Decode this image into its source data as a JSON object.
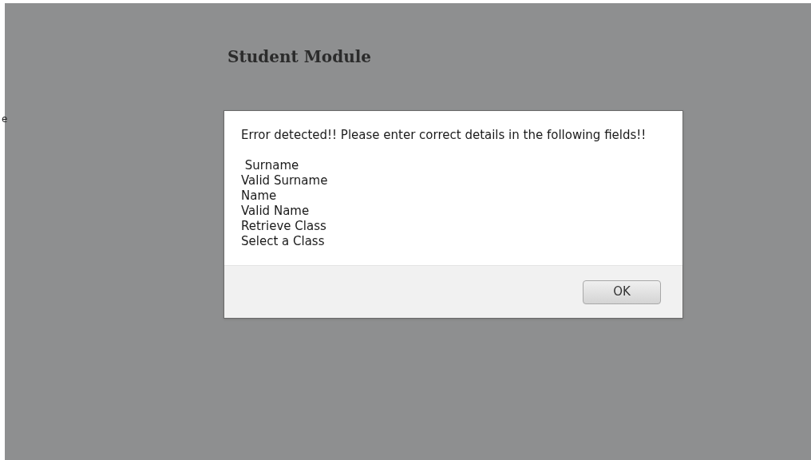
{
  "page": {
    "heading": "Student Module",
    "side_fragment": "e"
  },
  "dialog": {
    "message": "Error detected!! Please enter correct details in the following fields!!",
    "fields": [
      " Surname",
      "Valid Surname",
      "Name",
      "Valid Name",
      "Retrieve Class",
      "Select a Class"
    ],
    "buttons": [
      "OK"
    ]
  }
}
